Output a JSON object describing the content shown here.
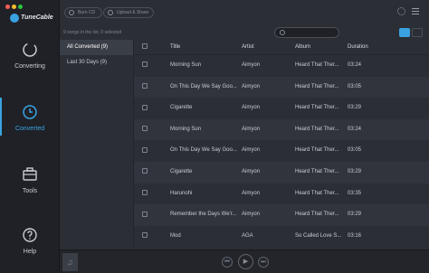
{
  "app": {
    "logo_text": "TuneCable"
  },
  "colors": {
    "accent": "#3aa2e0",
    "sidebar_bg": "#1f2127",
    "main_bg": "#2b2e35"
  },
  "sidebar": {
    "items": [
      {
        "label": "Converting",
        "icon": "converting-icon",
        "active": false
      },
      {
        "label": "Converted",
        "icon": "clock-icon",
        "active": true
      },
      {
        "label": "Tools",
        "icon": "toolbox-icon",
        "active": false
      },
      {
        "label": "Help",
        "icon": "help-icon",
        "active": false
      }
    ]
  },
  "toolbar": {
    "burn_cd_label": "Burn CD",
    "upload_share_label": "Upload & Share"
  },
  "status": {
    "text": "9 songs in the list, 0 selected"
  },
  "list_panel": {
    "items": [
      {
        "label": "All Converted (9)",
        "active": true
      },
      {
        "label": "Last 30 Days (9)",
        "active": false
      }
    ]
  },
  "table": {
    "headers": {
      "title": "Title",
      "artist": "Artist",
      "album": "Album",
      "duration": "Duration"
    },
    "rows": [
      {
        "title": "Morning Sun",
        "artist": "Aimyon",
        "album": "Heard That Ther...",
        "duration": "03:24"
      },
      {
        "title": "On This Day We Say Goo...",
        "artist": "Aimyon",
        "album": "Heard That Ther...",
        "duration": "03:05"
      },
      {
        "title": "Cigarette",
        "artist": "Aimyon",
        "album": "Heard That Ther...",
        "duration": "03:29"
      },
      {
        "title": "Morning Sun",
        "artist": "Aimyon",
        "album": "Heard That Ther...",
        "duration": "03:24"
      },
      {
        "title": "On This Day We Say Goo...",
        "artist": "Aimyon",
        "album": "Heard That Ther...",
        "duration": "03:05"
      },
      {
        "title": "Cigarette",
        "artist": "Aimyon",
        "album": "Heard That Ther...",
        "duration": "03:29"
      },
      {
        "title": "Harunohi",
        "artist": "Aimyon",
        "album": "Heard That Ther...",
        "duration": "03:35"
      },
      {
        "title": "Remember the Days We'r...",
        "artist": "Aimyon",
        "album": "Heard That Ther...",
        "duration": "03:29"
      },
      {
        "title": "Mod",
        "artist": "AGA",
        "album": "So Called Love S...",
        "duration": "03:16"
      }
    ]
  },
  "player": {
    "thumb_icon": "music-note-icon"
  }
}
